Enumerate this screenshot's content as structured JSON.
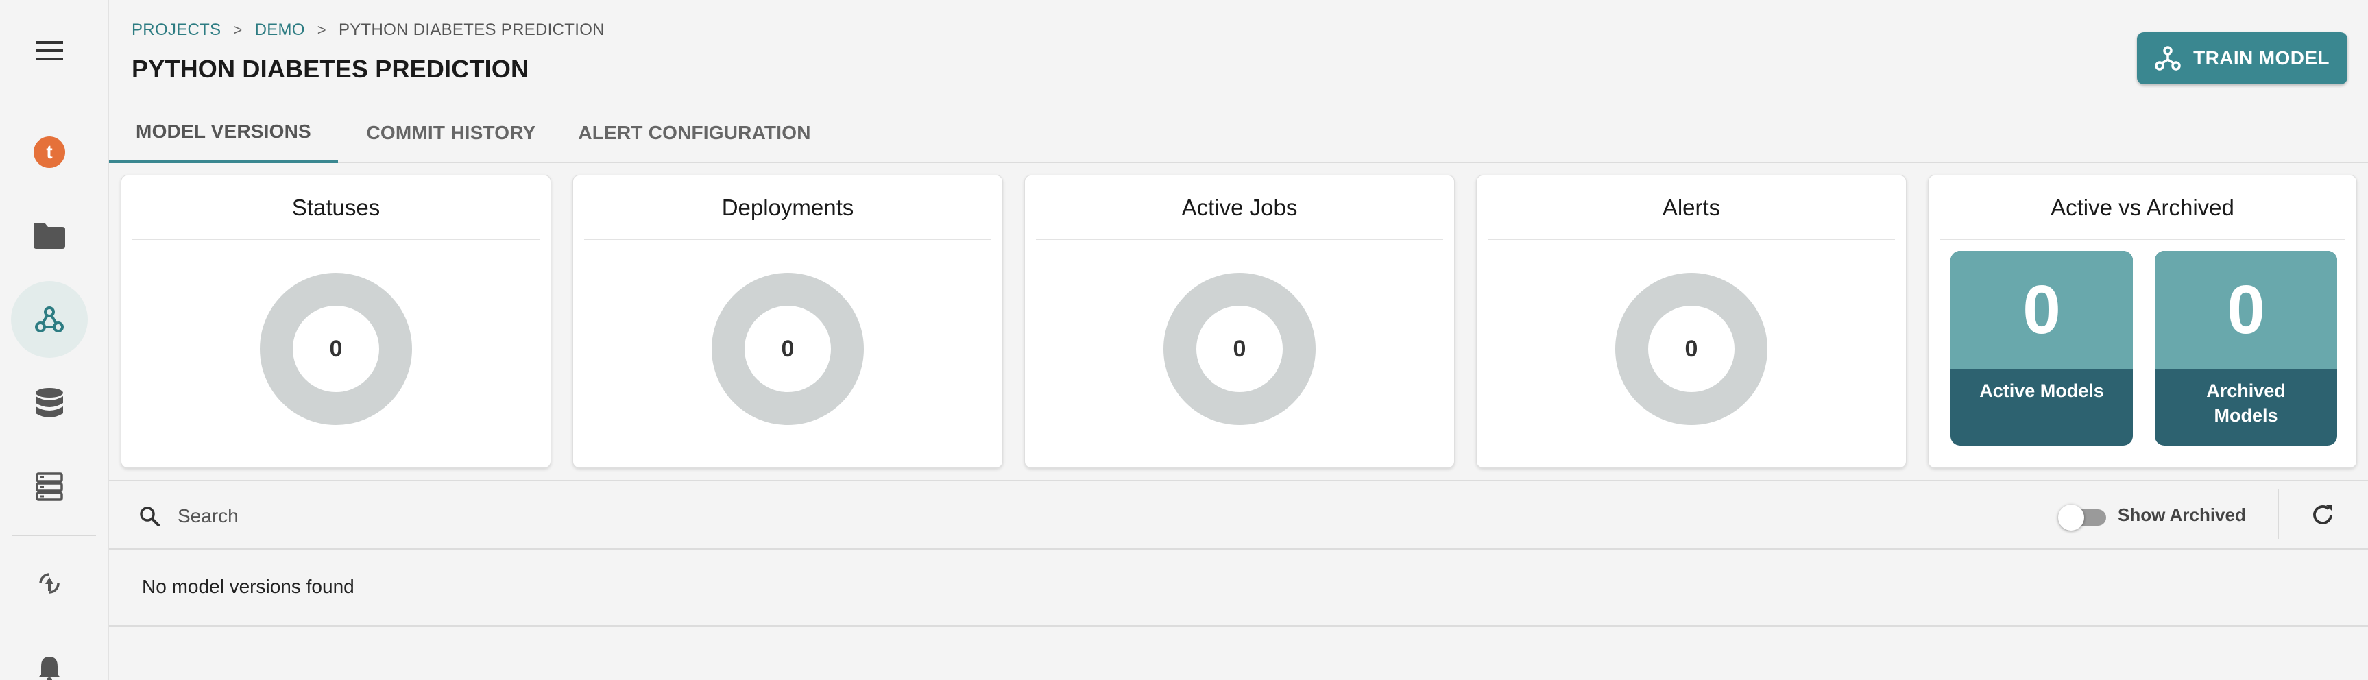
{
  "breadcrumb": {
    "items": [
      "PROJECTS",
      "DEMO"
    ],
    "separator": ">",
    "current": "PYTHON DIABETES PREDICTION"
  },
  "page_title": "PYTHON DIABETES PREDICTION",
  "train_button": {
    "label": "TRAIN MODEL",
    "icon": "model-graph-icon"
  },
  "tabs": [
    {
      "label": "MODEL VERSIONS",
      "active": true
    },
    {
      "label": "COMMIT HISTORY",
      "active": false
    },
    {
      "label": "ALERT CONFIGURATION",
      "active": false
    }
  ],
  "cards": [
    {
      "title": "Statuses",
      "value": "0"
    },
    {
      "title": "Deployments",
      "value": "0"
    },
    {
      "title": "Active Jobs",
      "value": "0"
    },
    {
      "title": "Alerts",
      "value": "0"
    }
  ],
  "active_vs_archived": {
    "title": "Active vs Archived",
    "active": {
      "count": "0",
      "label": "Active Models"
    },
    "archived": {
      "count": "0",
      "label": "Archived Models"
    }
  },
  "search": {
    "placeholder": "Search",
    "value": ""
  },
  "show_archived": {
    "label": "Show Archived",
    "on": false
  },
  "empty_message": "No model versions found",
  "sidebar": {
    "items": [
      {
        "icon": "menu-icon",
        "active": false
      },
      {
        "icon": "brand-logo-icon",
        "active": false
      },
      {
        "icon": "folder-icon",
        "active": false
      },
      {
        "icon": "models-icon",
        "active": true
      },
      {
        "icon": "database-icon",
        "active": false
      },
      {
        "icon": "server-icon",
        "active": false
      },
      {
        "icon": "deploy-icon",
        "active": false
      },
      {
        "icon": "bell-icon",
        "active": false
      }
    ]
  },
  "colors": {
    "accent": "#3a8790",
    "link": "#2d7c82",
    "tile_top": "#69a8ac",
    "tile_bottom": "#2d6270",
    "brand_orange": "#e5713a",
    "donut_ring": "#cfd3d3"
  }
}
